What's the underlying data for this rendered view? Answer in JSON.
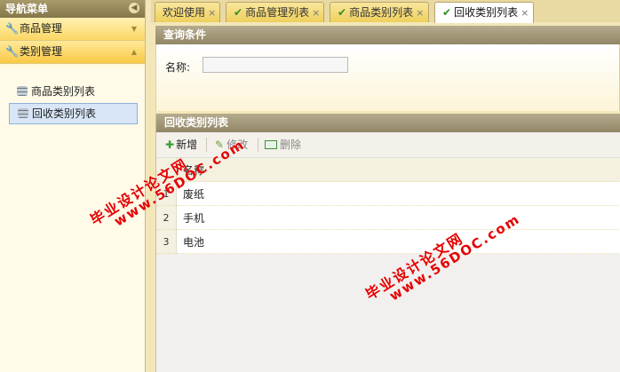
{
  "sidebar": {
    "title": "导航菜单",
    "collapse_icon": "chevron-left-icon",
    "sections": [
      {
        "label": "商品管理",
        "icon": "wrench-icon",
        "arrow": "chevron-down-icon",
        "open": false
      },
      {
        "label": "类别管理",
        "icon": "wrench-icon",
        "arrow": "chevron-up-icon",
        "open": true
      }
    ],
    "items": [
      {
        "label": "商品类别列表",
        "icon": "database-icon",
        "selected": false
      },
      {
        "label": "回收类别列表",
        "icon": "database-icon",
        "selected": true
      }
    ]
  },
  "tabs": [
    {
      "label": "欢迎使用",
      "checked": false,
      "active": false
    },
    {
      "label": "商品管理列表",
      "checked": true,
      "active": false
    },
    {
      "label": "商品类别列表",
      "checked": true,
      "active": false
    },
    {
      "label": "回收类别列表",
      "checked": true,
      "active": true
    }
  ],
  "tab_close_glyph": "×",
  "query": {
    "title": "查询条件",
    "name_label": "名称:",
    "name_value": ""
  },
  "list": {
    "title": "回收类别列表",
    "toolbar": {
      "add": "新增",
      "edit": "修改",
      "delete": "删除"
    },
    "columns": [
      "名称"
    ],
    "rows": [
      {
        "no": "1",
        "name": "废纸"
      },
      {
        "no": "2",
        "name": "手机"
      },
      {
        "no": "3",
        "name": "电池"
      }
    ]
  },
  "watermarks": [
    {
      "line1": "毕业设计论文网",
      "line2": "www.56DOC.com"
    },
    {
      "line1": "毕业设计论文网",
      "line2": "www.56DOC.com"
    }
  ],
  "colors": {
    "accent": "#f9c945",
    "selected": "#d8e6f8",
    "watermark": "#e50000"
  }
}
